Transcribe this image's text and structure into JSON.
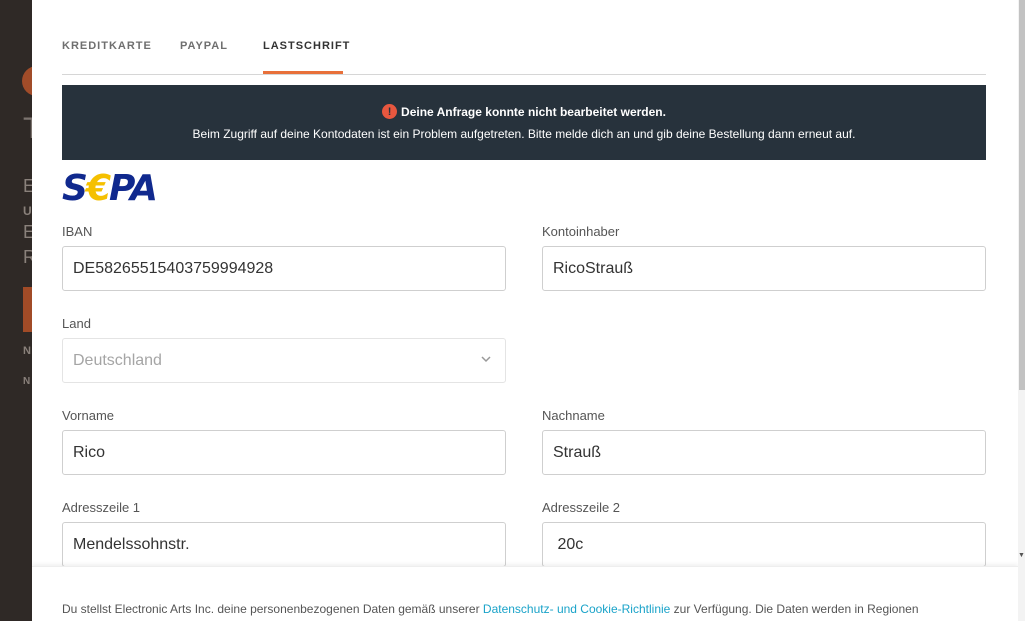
{
  "background": {
    "heading_char": "T",
    "line1": "E",
    "line2": "U",
    "line3": "E",
    "line4": "R",
    "line5": "N",
    "line6": "N"
  },
  "tabs": [
    {
      "label": "KREDITKARTE"
    },
    {
      "label": "PAYPAL"
    },
    {
      "label": "LASTSCHRIFT"
    }
  ],
  "active_tab": "LASTSCHRIFT",
  "alert": {
    "icon": "exclamation-circle-icon",
    "title": "Deine Anfrage konnte nicht bearbeitet werden.",
    "message": "Beim Zugriff auf deine Kontodaten ist ein Problem aufgetreten. Bitte melde dich an und gib deine Bestellung dann erneut auf."
  },
  "sepa_logo": {
    "text_left": "S",
    "text_euro": "€",
    "text_right": "PA"
  },
  "form": {
    "iban": {
      "label": "IBAN",
      "value": "DE58265515403759994928"
    },
    "kontoinhaber": {
      "label": "Kontoinhaber",
      "value": "RicoStrauß"
    },
    "land": {
      "label": "Land",
      "value": "Deutschland"
    },
    "vorname": {
      "label": "Vorname",
      "value": "Rico"
    },
    "nachname": {
      "label": "Nachname",
      "value": "Strauß"
    },
    "adresse1": {
      "label": "Adresszeile 1",
      "value": "Mendelssohnstr."
    },
    "adresse2": {
      "label": "Adresszeile 2",
      "value": " 20c"
    }
  },
  "footer": {
    "text_before": "Du stellst Electronic Arts Inc. deine personenbezogenen Daten gemäß unserer ",
    "link": "Datenschutz- und Cookie-Richtlinie",
    "text_after": " zur Verfügung. Die Daten werden in Regionen"
  },
  "colors": {
    "accent": "#e8703a",
    "alert_bg": "#27323c",
    "link": "#1aa3c9",
    "sepa_blue": "#10298e",
    "sepa_yellow": "#f5c000"
  }
}
